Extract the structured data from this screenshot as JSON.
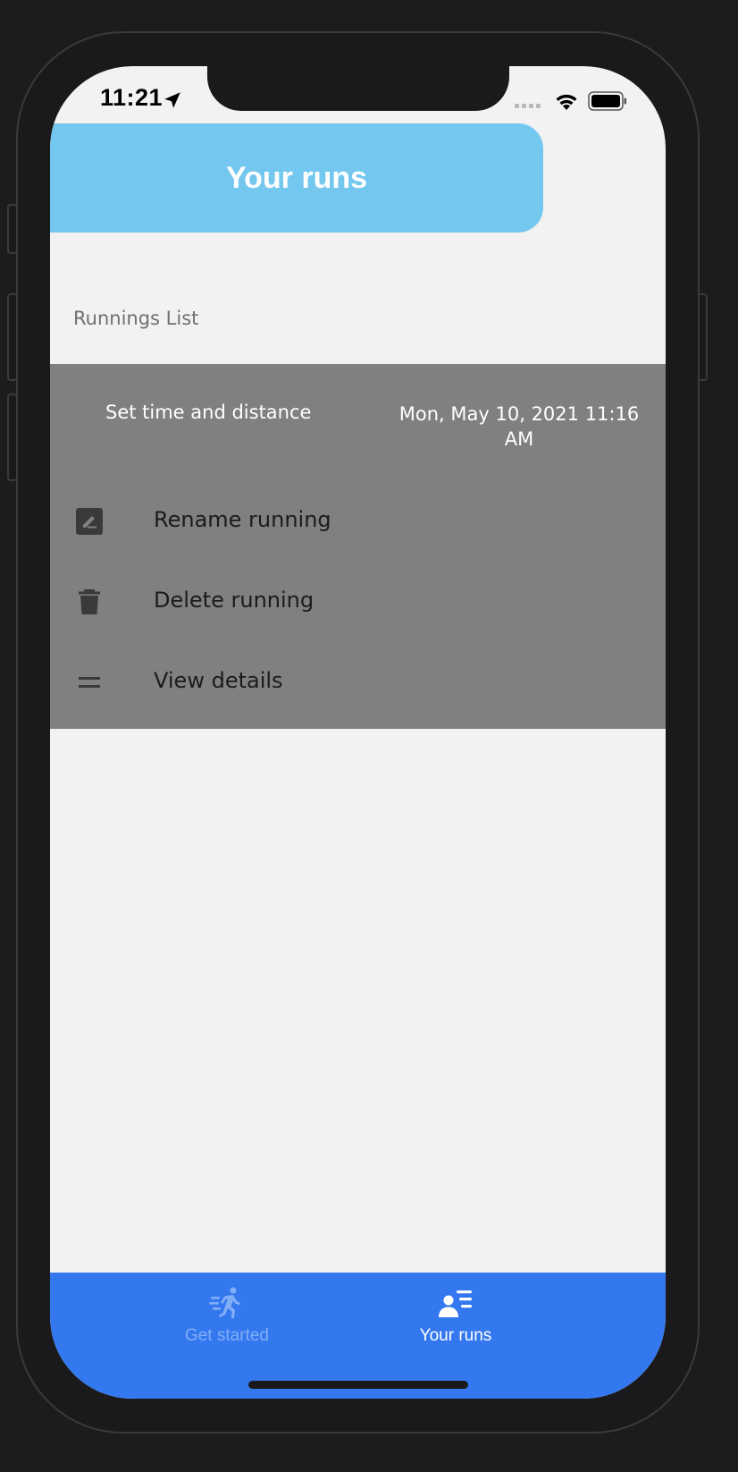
{
  "status_bar": {
    "time": "11:21",
    "icons": [
      "location-arrow-icon",
      "signal-icon",
      "wifi-icon",
      "battery-icon"
    ]
  },
  "header": {
    "title": "Your runs",
    "background": "#74c7ef"
  },
  "list": {
    "section_label": "Runnings List",
    "items": [
      {
        "title": "Set time and distance",
        "date": "Mon, May 10, 2021 11:16 AM",
        "actions": [
          {
            "label": "Rename running",
            "icon": "edit-icon"
          },
          {
            "label": "Delete running",
            "icon": "trash-icon"
          },
          {
            "label": "View details",
            "icon": "equals-icon"
          }
        ]
      }
    ],
    "panel_color": "#808080"
  },
  "tab_bar": {
    "background": "#3478f0",
    "tabs": [
      {
        "label": "Get started",
        "icon": "running-person-icon",
        "active": false
      },
      {
        "label": "Your runs",
        "icon": "user-list-icon",
        "active": true
      }
    ]
  }
}
